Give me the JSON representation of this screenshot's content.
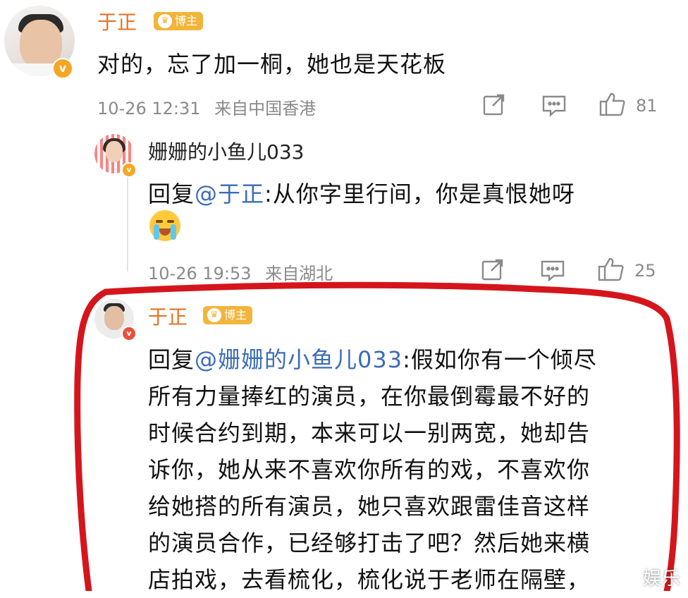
{
  "comment": {
    "author": "于正",
    "badge": "博主",
    "verified_mark": "v",
    "text": "对的，忘了加一桐，她也是天花板",
    "time": "10-26 12:31",
    "source": "来自中国香港",
    "likes": "81"
  },
  "reply1": {
    "author": "姗姗的小鱼儿033",
    "verified_mark": "v",
    "prefix": "回复",
    "mention": "@于正",
    "text": ":从你字里行间，你是真恨她呀",
    "emoji_icon": "crying-face-emoji",
    "time": "10-26 19:53",
    "source": "来自湖北",
    "likes": "25"
  },
  "reply2": {
    "author": "于正",
    "badge": "博主",
    "verified_mark": "v",
    "prefix": "回复",
    "mention": "@姗姗的小鱼儿033",
    "first_line": ":假如你有一个倾尽",
    "lines": [
      "所有力量捧红的演员，在你最倒霉最不好的",
      "时候合约到期，本来可以一别两宽，她却告",
      "诉你，她从来不喜欢你所有的戏，不喜欢你",
      "给她搭的所有演员，她只喜欢跟雷佳音这样",
      "的演员合作，已经够打击了吧？然后她来横",
      "店拍戏，去看梳化，梳化说于老师在隔壁，"
    ]
  },
  "watermark": "娱乐",
  "colors": {
    "name": "#e37225",
    "badge": "#f2b53b",
    "mention": "#3a6cb8",
    "highlight": "#d4161c",
    "meta": "#8a8a8a"
  },
  "icons": [
    "share-icon",
    "comment-icon",
    "like-icon"
  ]
}
